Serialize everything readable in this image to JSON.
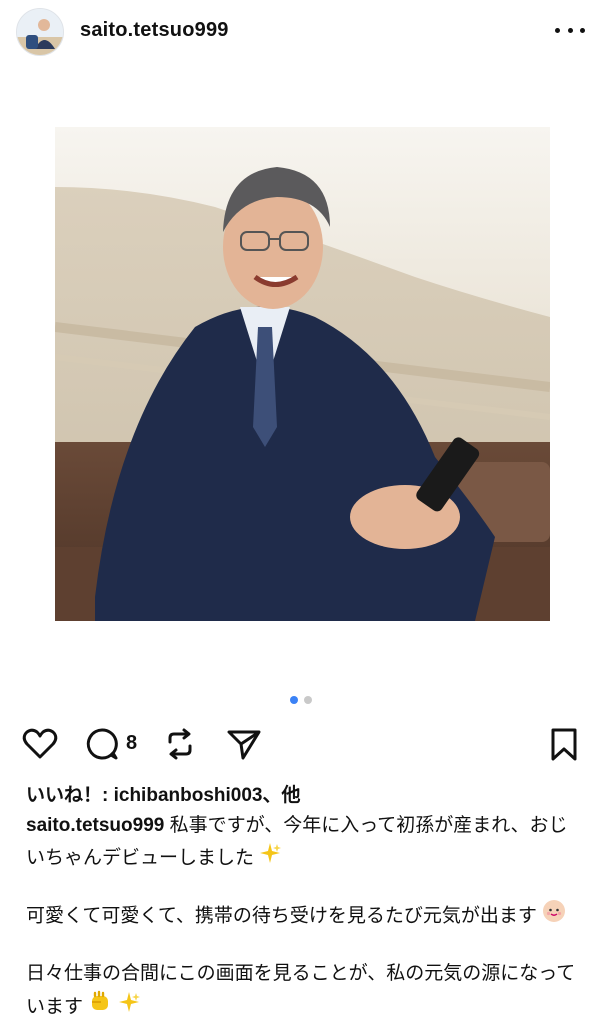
{
  "header": {
    "username": "saito.tetsuo999"
  },
  "post": {
    "comment_count": "8",
    "likes_text": "いいね！: ichibanboshi003、他",
    "caption_user": "saito.tetsuo999",
    "caption_p1": " 私事ですが、今年に入って初孫が産まれ、おじいちゃんデビューしました",
    "caption_p2": "可愛くて可愛くて、携帯の待ち受けを見るたび元気が出ます",
    "caption_p3": "日々仕事の合間にこの画面を見ることが、私の元気の源になっています"
  },
  "carousel": {
    "total": 2,
    "active_index": 0
  },
  "icons": {
    "more": "more-icon",
    "like": "heart-icon",
    "comment": "comment-icon",
    "repost": "repost-icon",
    "share": "send-icon",
    "save": "bookmark-icon",
    "sparkles": "sparkles-emoji",
    "baby": "baby-emoji",
    "fist": "fist-emoji"
  },
  "colors": {
    "accent": "#3b82f6"
  }
}
